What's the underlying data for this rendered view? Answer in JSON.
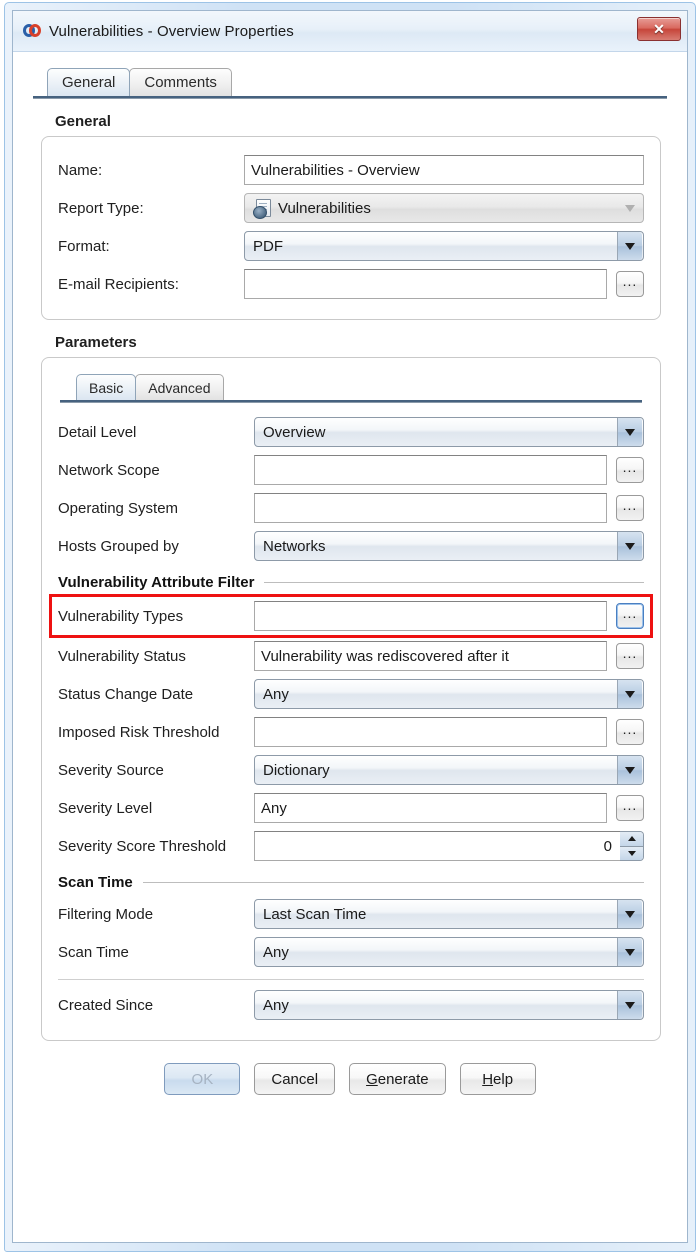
{
  "window": {
    "title": "Vulnerabilities - Overview Properties",
    "icon": "vulnerability-rings-icon",
    "close_label": "✕"
  },
  "tabs": [
    {
      "label": "General",
      "active": true
    },
    {
      "label": "Comments",
      "active": false
    }
  ],
  "general": {
    "group_label": "General",
    "fields": {
      "name_label": "Name:",
      "name_value": "Vulnerabilities - Overview",
      "report_type_label": "Report Type:",
      "report_type_value": "Vulnerabilities",
      "format_label": "Format:",
      "format_value": "PDF",
      "email_label": "E-mail Recipients:",
      "email_value": "",
      "email_browse": "..."
    }
  },
  "parameters": {
    "group_label": "Parameters",
    "tabs": [
      {
        "label": "Basic",
        "active": true
      },
      {
        "label": "Advanced",
        "active": false
      }
    ],
    "rows": {
      "detail_level_label": "Detail Level",
      "detail_level_value": "Overview",
      "network_scope_label": "Network Scope",
      "network_scope_value": "",
      "operating_system_label": "Operating System",
      "operating_system_value": "",
      "hosts_grouped_label": "Hosts Grouped by",
      "hosts_grouped_value": "Networks",
      "vuln_attr_filter_header": "Vulnerability Attribute Filter",
      "vuln_types_label": "Vulnerability Types",
      "vuln_types_value": "",
      "vuln_status_label": "Vulnerability Status",
      "vuln_status_value": "Vulnerability was rediscovered after it",
      "status_change_date_label": "Status Change Date",
      "status_change_date_value": "Any",
      "imposed_risk_label": "Imposed Risk Threshold",
      "imposed_risk_value": "",
      "severity_source_label": "Severity Source",
      "severity_source_value": "Dictionary",
      "severity_level_label": "Severity Level",
      "severity_level_value": "Any",
      "severity_score_label": "Severity Score Threshold",
      "severity_score_value": "0",
      "scan_time_header": "Scan Time",
      "filtering_mode_label": "Filtering Mode",
      "filtering_mode_value": "Last Scan Time",
      "scan_time_label": "Scan Time",
      "scan_time_value": "Any",
      "created_since_label": "Created Since",
      "created_since_value": "Any"
    },
    "browse_label": "..."
  },
  "footer": {
    "ok": "OK",
    "cancel": "Cancel",
    "generate_pre": "G",
    "generate_rest": "enerate",
    "help_pre": "H",
    "help_rest": "elp"
  },
  "colors": {
    "highlight": "#ee1111",
    "frame": "#cfe2f5",
    "accent": "#46627f"
  }
}
